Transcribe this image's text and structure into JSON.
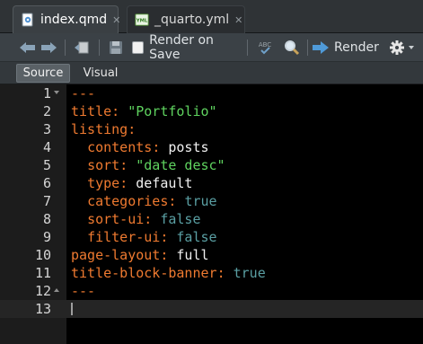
{
  "tabs": [
    {
      "label": "index.qmd",
      "active": true,
      "icon": "quarto-doc-icon"
    },
    {
      "label": "_quarto.yml",
      "active": false,
      "icon": "yml-file-icon"
    }
  ],
  "toolbar": {
    "render_on_save": "Render on Save",
    "render": "Render",
    "spellcheck_badge": "ABC"
  },
  "modes": {
    "source": "Source",
    "visual": "Visual"
  },
  "lines": [
    {
      "num": "1",
      "fold": "down"
    },
    {
      "num": "2"
    },
    {
      "num": "3"
    },
    {
      "num": "4"
    },
    {
      "num": "5"
    },
    {
      "num": "6"
    },
    {
      "num": "7"
    },
    {
      "num": "8"
    },
    {
      "num": "9"
    },
    {
      "num": "10"
    },
    {
      "num": "11"
    },
    {
      "num": "12",
      "fold": "up"
    },
    {
      "num": "13",
      "current": true
    }
  ],
  "code": {
    "l1": {
      "dash": "---"
    },
    "l2": {
      "key": "title",
      "colon": ": ",
      "val": "\"Portfolio\""
    },
    "l3": {
      "key": "listing",
      "colon": ":"
    },
    "l4": {
      "indent": "  ",
      "key": "contents",
      "colon": ": ",
      "val": "posts"
    },
    "l5": {
      "indent": "  ",
      "key": "sort",
      "colon": ": ",
      "val": "\"date desc\""
    },
    "l6": {
      "indent": "  ",
      "key": "type",
      "colon": ": ",
      "val": "default"
    },
    "l7": {
      "indent": "  ",
      "key": "categories",
      "colon": ": ",
      "val": "true"
    },
    "l8": {
      "indent": "  ",
      "key": "sort-ui",
      "colon": ": ",
      "val": "false"
    },
    "l9": {
      "indent": "  ",
      "key": "filter-ui",
      "colon": ": ",
      "val": "false"
    },
    "l10": {
      "key": "page-layout",
      "colon": ": ",
      "val": "full"
    },
    "l11": {
      "key": "title-block-banner",
      "colon": ": ",
      "val": "true"
    },
    "l12": {
      "dash": "---"
    }
  },
  "colors": {
    "key": "#ef7a30",
    "string": "#5fd35f",
    "plain": "#f0f0f0",
    "bool": "#5a9fa3"
  }
}
